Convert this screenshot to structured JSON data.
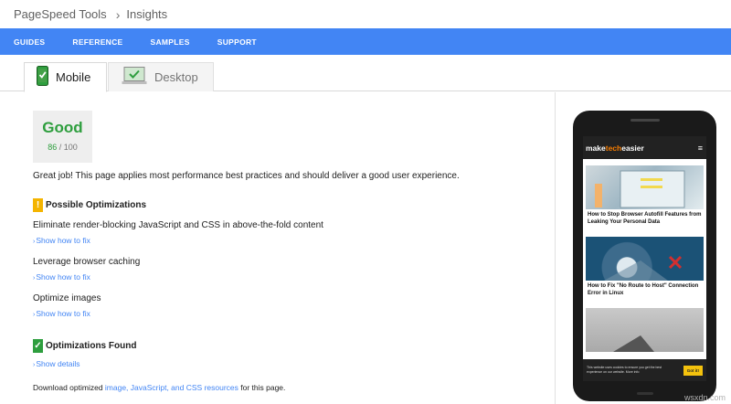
{
  "breadcrumb": {
    "root": "PageSpeed Tools",
    "separator": "›",
    "current": "Insights"
  },
  "nav": {
    "items": [
      "GUIDES",
      "REFERENCE",
      "SAMPLES",
      "SUPPORT"
    ]
  },
  "tabs": {
    "mobile": "Mobile",
    "desktop": "Desktop"
  },
  "score": {
    "label": "Good",
    "value": "86",
    "max": "/ 100"
  },
  "summary": "Great job! This page applies most performance best practices and should deliver a good user experience.",
  "possible": {
    "title": "Possible Optimizations",
    "badge": "!",
    "rules": [
      {
        "title": "Eliminate render-blocking JavaScript and CSS in above-the-fold content",
        "link": "Show how to fix"
      },
      {
        "title": "Leverage browser caching",
        "link": "Show how to fix"
      },
      {
        "title": "Optimize images",
        "link": "Show how to fix"
      }
    ]
  },
  "found": {
    "title": "Optimizations Found",
    "badge": "✓",
    "link": "Show details"
  },
  "download": {
    "prefix": "Download optimized ",
    "link": "image, JavaScript, and CSS resources",
    "suffix": " for this page."
  },
  "preview": {
    "logo_a": "make",
    "logo_b": "tech",
    "logo_c": "easier",
    "menu": "≡",
    "articles": [
      {
        "title": "How to Stop Browser Autofill Features from Leaking Your Personal Data"
      },
      {
        "title": "How to Fix \"No Route to Host\" Connection Error in Linux"
      }
    ],
    "cookie_text": "This website uses cookies to ensure you get the best experience on our website. More info",
    "cookie_button": "Got it!"
  },
  "watermark": "wsxdn.com",
  "colors": {
    "nav": "#4285f4",
    "good": "#2e9e3e",
    "warn": "#f4b400",
    "link": "#4285f4"
  }
}
